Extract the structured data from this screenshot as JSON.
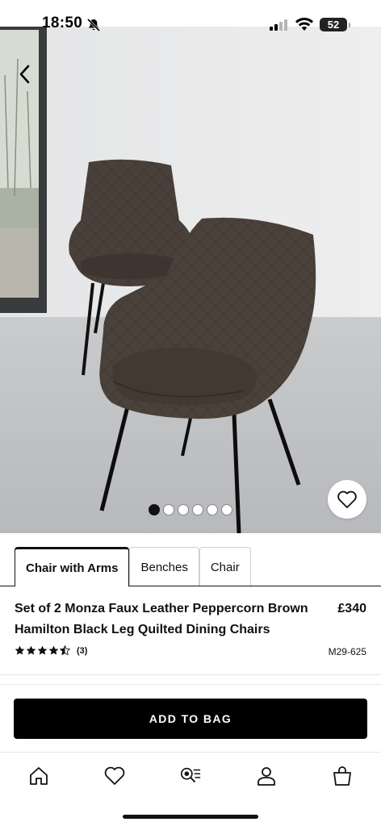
{
  "status_bar": {
    "time": "18:50",
    "battery": "52",
    "icons": [
      "bell-off-icon",
      "signal-icon",
      "wifi-icon",
      "battery-icon"
    ]
  },
  "gallery": {
    "image_count": 6,
    "current_index": 1,
    "back_icon": "chevron-left-icon",
    "favourite_icon": "heart-outline-icon"
  },
  "variants": [
    {
      "label": "Chair with Arms",
      "selected": true
    },
    {
      "label": "Benches",
      "selected": false
    },
    {
      "label": "Chair",
      "selected": false
    }
  ],
  "product": {
    "title": "Set of 2 Monza Faux Leather Peppercorn Brown Hamilton Black Leg Quilted Dining Chairs",
    "price": "£340",
    "rating": 4.5,
    "review_count": "(3)",
    "sku": "M29-625"
  },
  "cta": {
    "add_to_bag": "ADD TO BAG"
  },
  "bottom_nav": {
    "items": [
      "home-icon",
      "heart-icon",
      "visual-search-icon",
      "account-icon",
      "bag-icon"
    ]
  },
  "colors": {
    "primary": "#000000",
    "background": "#ffffff",
    "chair_upholstery": "#4a403a"
  }
}
